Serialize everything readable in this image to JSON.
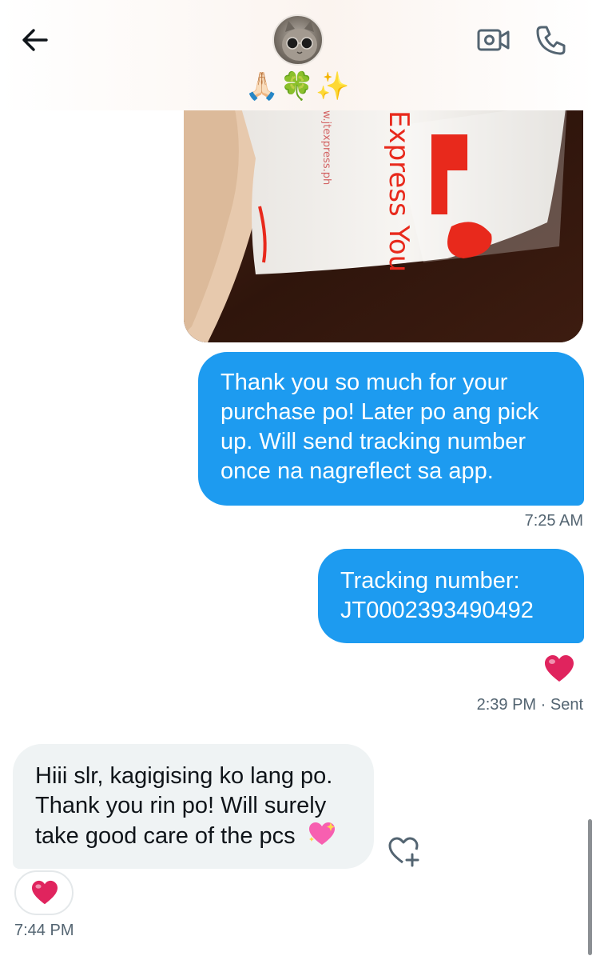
{
  "header": {
    "contact_name": "🙏🏻🍀✨",
    "avatar": "cat-with-glasses-avatar",
    "back_icon": "arrow-left-icon",
    "video_icon": "video-call-icon",
    "phone_icon": "phone-call-icon"
  },
  "photo": {
    "package_print_1": "Express You",
    "package_print_2": "w.jtexpress.ph"
  },
  "messages": [
    {
      "direction": "sent",
      "text": "Thank you so much for your purchase po! Later po ang pick up. Will send tracking number once na nagreflect sa app.",
      "time": "7:25 AM"
    },
    {
      "direction": "sent",
      "text": "Tracking number: JT0002393490492",
      "time": "2:39 PM",
      "status": "· Sent",
      "reaction": "❤️"
    },
    {
      "direction": "received",
      "text": "Hiii slr, kagigising ko lang po. Thank you rin po! Will surely take good care of the pcs",
      "emoji": "💖",
      "time": "7:44 PM",
      "reaction": "❤️"
    }
  ],
  "colors": {
    "sent_bubble": "#1d9bf0",
    "received_bubble": "#eff3f4",
    "meta_text": "#536471",
    "heart": "#e0245e"
  }
}
